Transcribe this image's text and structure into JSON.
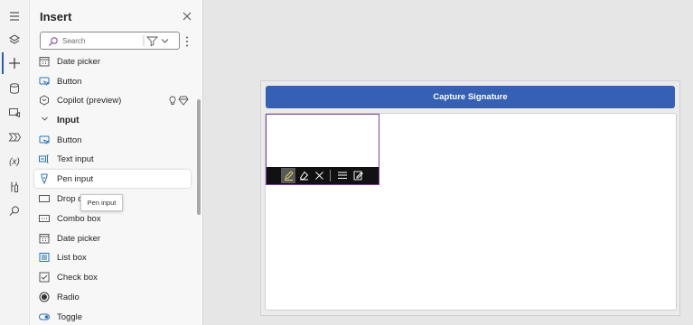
{
  "insert_panel": {
    "title": "Insert",
    "search_placeholder": "Search",
    "items": [
      {
        "label": "Date picker",
        "icon": "calendar-icon"
      },
      {
        "label": "Button",
        "icon": "button-icon"
      },
      {
        "label": "Copilot (preview)",
        "icon": "copilot-icon"
      },
      {
        "label": "Input",
        "icon": "chevron-down-icon",
        "section": true
      },
      {
        "label": "Button",
        "icon": "button-icon"
      },
      {
        "label": "Text input",
        "icon": "text-input-icon"
      },
      {
        "label": "Pen input",
        "icon": "pen-icon",
        "selected": true
      },
      {
        "label": "Drop d",
        "icon": "dropdown-icon"
      },
      {
        "label": "Combo box",
        "icon": "combo-box-icon"
      },
      {
        "label": "Date picker",
        "icon": "calendar-icon"
      },
      {
        "label": "List box",
        "icon": "list-box-icon"
      },
      {
        "label": "Check box",
        "icon": "check-box-icon"
      },
      {
        "label": "Radio",
        "icon": "radio-icon"
      },
      {
        "label": "Toggle",
        "icon": "toggle-icon"
      }
    ],
    "tooltip": "Pen input"
  },
  "rail": {
    "icons": [
      "hamburger-icon",
      "layers-icon",
      "plus-icon",
      "database-icon",
      "media-icon",
      "power-automate-icon",
      "variables-icon",
      "tools-icon",
      "search-icon"
    ],
    "variables_label": "(x)"
  },
  "canvas": {
    "capture_button_label": "Capture Signature",
    "accent_color": "#3660b3",
    "selection_color": "#7a3fa0"
  }
}
